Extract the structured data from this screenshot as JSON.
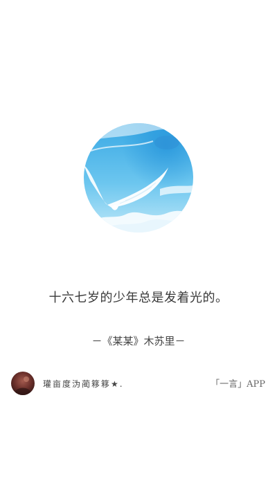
{
  "hero": {
    "image": "sky-with-flying-wings",
    "colors": {
      "sky": "#4fb8ea",
      "sky_light": "#a9dff5",
      "cloud": "#ffffff"
    }
  },
  "quote": {
    "text": "十六七岁的少年总是发着光的。"
  },
  "source": {
    "text": "－《某某》木苏里－"
  },
  "author": {
    "avatar": "user-avatar",
    "name": "瓘亩度沩蔺簃簃★."
  },
  "app": {
    "label": "「一言」APP"
  }
}
